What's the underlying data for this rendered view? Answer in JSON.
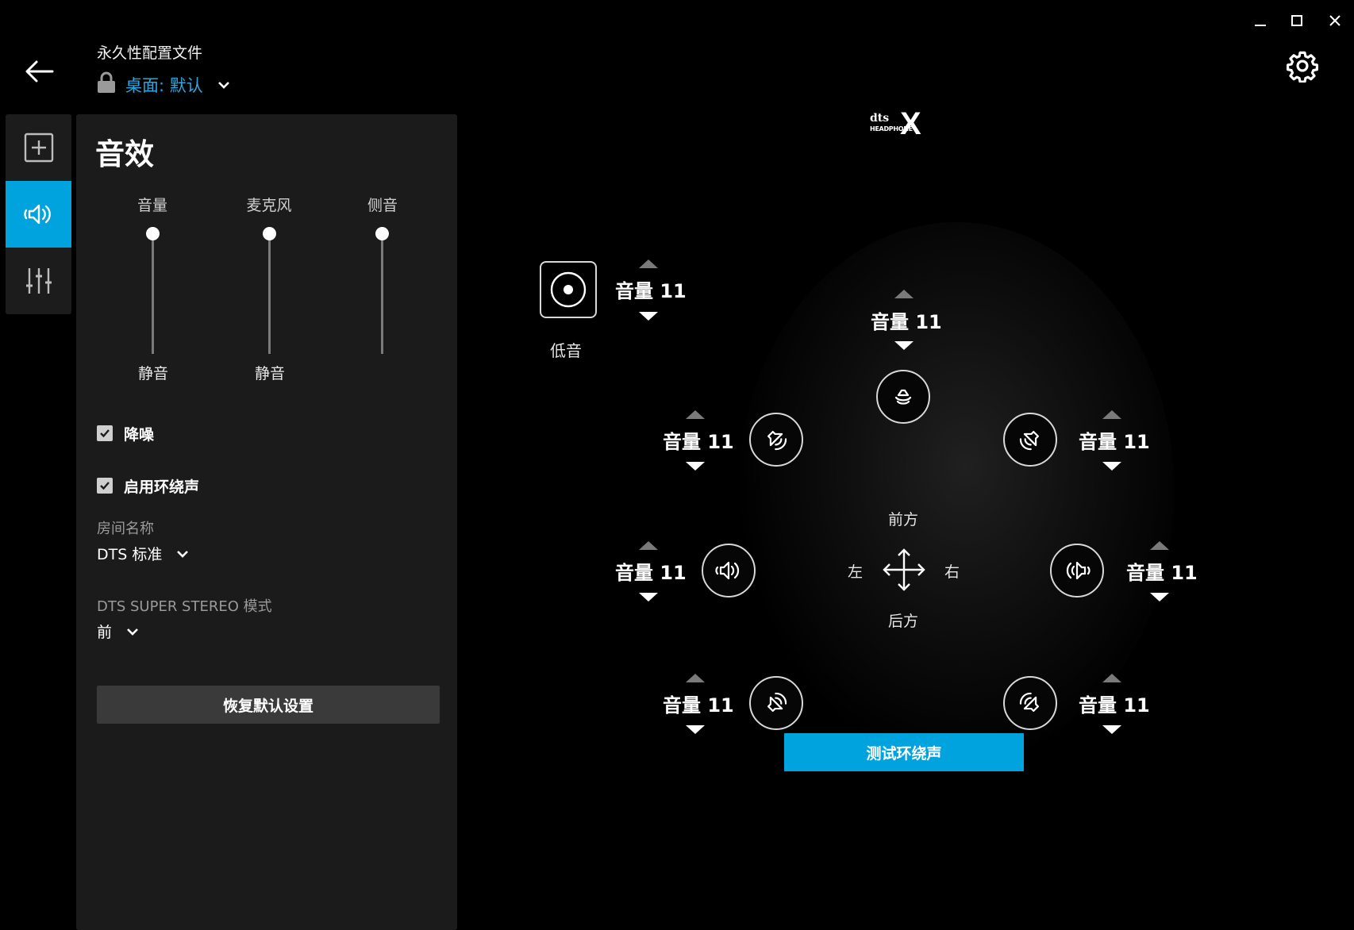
{
  "window": {
    "minimize": "minimize",
    "maximize": "maximize",
    "close": "close"
  },
  "header": {
    "profile_caption": "永久性配置文件",
    "profile_value": "桌面: 默认"
  },
  "rail": {
    "items": [
      "add",
      "sound",
      "equalizer"
    ],
    "active": "sound"
  },
  "panel": {
    "title": "音效",
    "sliders": [
      {
        "label": "音量",
        "bottom_label": "静音",
        "level": 1.0
      },
      {
        "label": "麦克风",
        "bottom_label": "静音",
        "level": 1.0
      },
      {
        "label": "侧音",
        "bottom_label": "",
        "level": 1.0
      }
    ],
    "noise_reduction": {
      "label": "降噪",
      "checked": true
    },
    "surround": {
      "label": "启用环绕声",
      "checked": true
    },
    "room": {
      "label": "房间名称",
      "value": "DTS 标准"
    },
    "stereo_mode": {
      "label": "DTS SUPER STEREO 模式",
      "value": "前"
    },
    "reset_label": "恢复默认设置"
  },
  "stage": {
    "logo": {
      "top": "dts",
      "bottom": "HEADPHONE",
      "mark": "X"
    },
    "subwoofer": {
      "label": "低音",
      "volume": "音量 11"
    },
    "center": {
      "volume": "音量 11"
    },
    "front_left": {
      "volume": "音量 11"
    },
    "front_right": {
      "volume": "音量 11"
    },
    "side_left": {
      "volume": "音量 11"
    },
    "side_right": {
      "volume": "音量 11"
    },
    "rear_left": {
      "volume": "音量 11"
    },
    "rear_right": {
      "volume": "音量 11"
    },
    "directions": {
      "front": "前方",
      "back": "后方",
      "left": "左",
      "right": "右"
    },
    "test_label": "测试环绕声"
  },
  "colors": {
    "accent": "#00a3de",
    "link": "#2aa7e0",
    "panel": "#1b1b1b",
    "background": "#000000"
  }
}
